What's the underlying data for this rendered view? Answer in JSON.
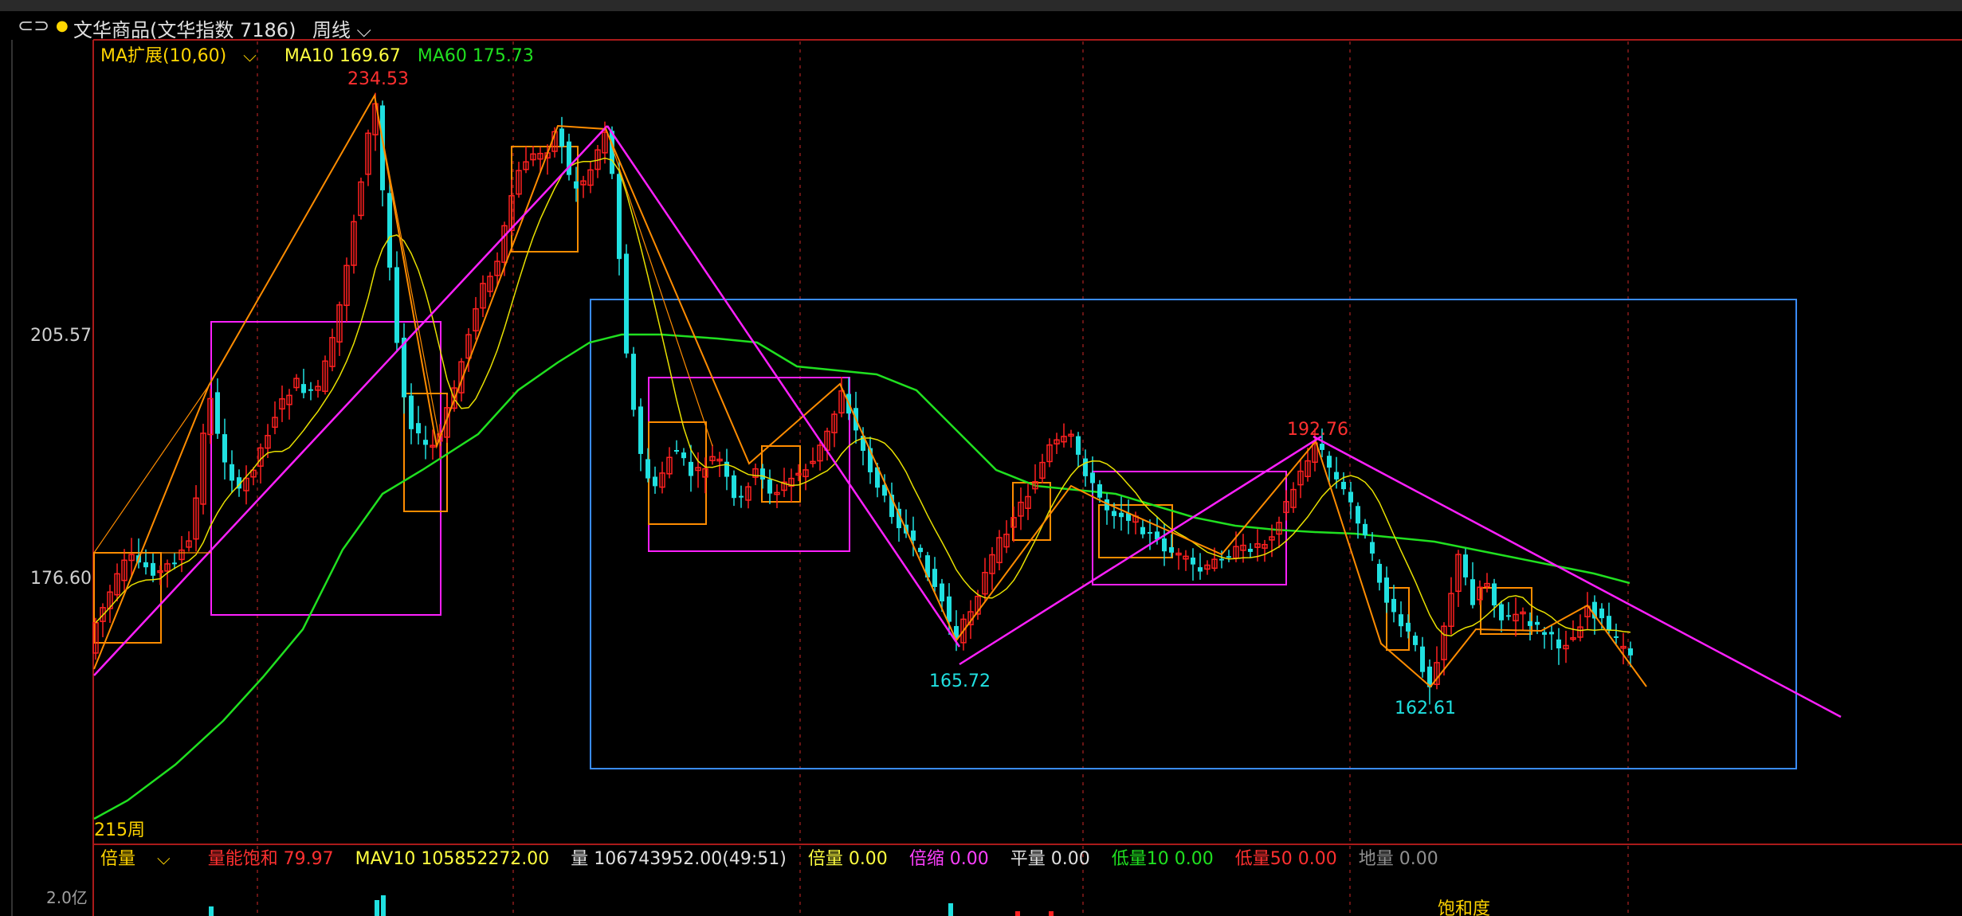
{
  "header": {
    "title": "文华商品(文华指数 7186)",
    "period": "周线"
  },
  "ma_legend": {
    "label": "MA扩展(10,60)",
    "ma10": "MA10 169.67",
    "ma60": "MA60 175.73"
  },
  "axis": {
    "price_labels": [
      "205.57",
      "176.60"
    ],
    "period_label": "215周",
    "vol_label": "2.0亿"
  },
  "annotations": {
    "high1": "234.53",
    "high2": "192.76",
    "low1": "165.72",
    "low2": "162.61",
    "bottom_text": "饱和度"
  },
  "vol_legend": {
    "mode": "倍量",
    "items": [
      {
        "text": "量能饱和 79.97",
        "color": "#ff3030"
      },
      {
        "text": "MAV10 105852272.00",
        "color": "#ffff40"
      },
      {
        "text": "量 106743952.00(49:51)",
        "color": "#e0e0e0"
      },
      {
        "text": "倍量 0.00",
        "color": "#ffff40"
      },
      {
        "text": "倍缩 0.00",
        "color": "#ff40ff"
      },
      {
        "text": "平量 0.00",
        "color": "#e0e0e0"
      },
      {
        "text": "低量10 0.00",
        "color": "#20e020"
      },
      {
        "text": "低量50 0.00",
        "color": "#ff3030"
      },
      {
        "text": "地量 0.00",
        "color": "#909090"
      }
    ]
  },
  "chart_data": {
    "type": "candlestick",
    "y_axis": {
      "ticks": [
        205.57,
        176.6
      ]
    },
    "extremes": [
      {
        "type": "high",
        "value": 234.53
      },
      {
        "type": "high",
        "value": 192.76
      },
      {
        "type": "low",
        "value": 165.72
      },
      {
        "type": "low",
        "value": 162.61
      }
    ],
    "ma10_last": 169.67,
    "ma60_last": 175.73,
    "colors": {
      "up": "#ff2020",
      "down": "#20e0e0",
      "ma10": "#e8e000",
      "ma60": "#20e020",
      "zigzag": "#ff8c00",
      "trendline": "#ff20ff",
      "box": "#3a8cff"
    }
  }
}
